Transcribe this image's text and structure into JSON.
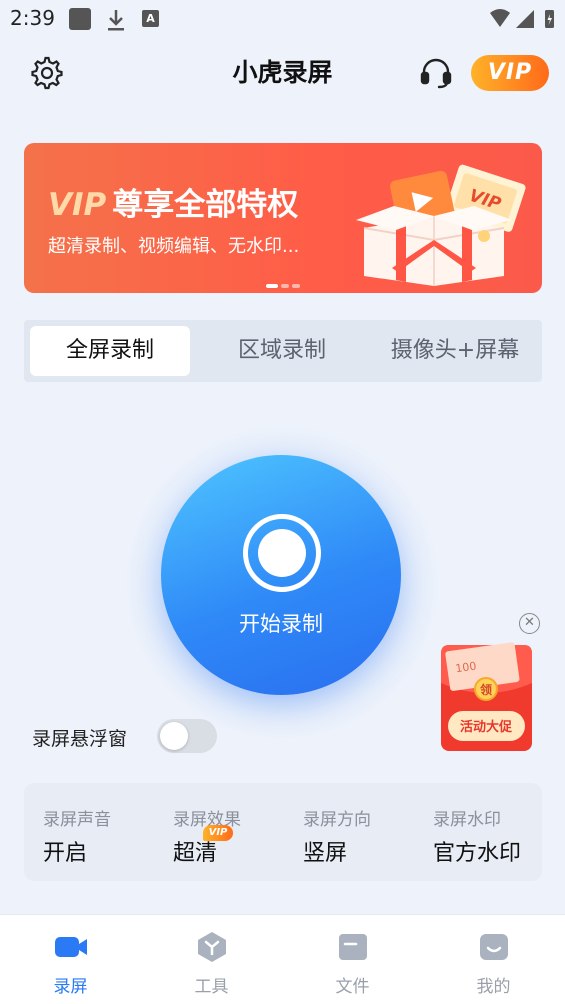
{
  "status_bar": {
    "time": "2:39",
    "icons": [
      "app-square-icon",
      "download-icon",
      "a-icon",
      "wifi-icon",
      "signal-icon",
      "battery-icon"
    ]
  },
  "header": {
    "title": "小虎录屏",
    "vip_label": "VIP",
    "icons": [
      "gear-icon",
      "headset-icon"
    ]
  },
  "banner": {
    "title_vip": "VIP",
    "title_rest": "尊享全部特权",
    "subtitle": "超清录制、视频编辑、无水印...",
    "gift_label": "VIP",
    "pages": 3,
    "active_page": 1
  },
  "mode_tabs": [
    {
      "label": "全屏录制",
      "active": true
    },
    {
      "label": "区域录制",
      "active": false
    },
    {
      "label": "摄像头+屏幕",
      "active": false
    }
  ],
  "record": {
    "label": "开始录制"
  },
  "floating_window": {
    "label": "录屏悬浮窗",
    "enabled": false
  },
  "promo": {
    "label": "活动大促",
    "coin_text": "领",
    "note_text": "100"
  },
  "settings": [
    {
      "label": "录屏声音",
      "value": "开启",
      "vip": false
    },
    {
      "label": "录屏效果",
      "value": "超清",
      "vip": true,
      "badge": "VIP"
    },
    {
      "label": "录屏方向",
      "value": "竖屏",
      "vip": false
    },
    {
      "label": "录屏水印",
      "value": "官方水印",
      "vip": false
    }
  ],
  "bottom_nav": [
    {
      "label": "录屏",
      "icon": "video-camera-icon",
      "active": true
    },
    {
      "label": "工具",
      "icon": "toolbox-icon",
      "active": false
    },
    {
      "label": "文件",
      "icon": "folder-icon",
      "active": false
    },
    {
      "label": "我的",
      "icon": "profile-icon",
      "active": false
    }
  ],
  "colors": {
    "accent": "#2a7af5",
    "vip_orange": "#ff6a1a",
    "banner_red": "#ff5d47",
    "background": "#eef3fb"
  }
}
